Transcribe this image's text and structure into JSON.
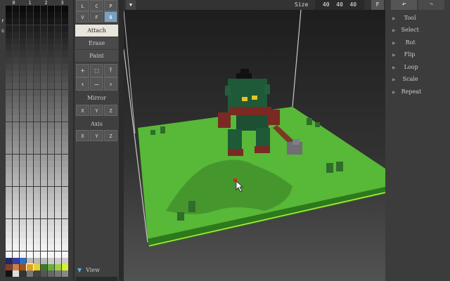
{
  "palette": {
    "columns": [
      "0",
      "1",
      "2",
      "3"
    ],
    "side_labels": [
      "F",
      "G"
    ]
  },
  "toolbar": {
    "mode_row1": [
      "L",
      "C",
      "P"
    ],
    "mode_row2": [
      "V",
      "F",
      "B"
    ],
    "attach_label": "Attach",
    "erase_label": "Erase",
    "paint_label": "Paint",
    "nav_row1": [
      "✛",
      "⬚",
      "⤒"
    ],
    "nav_row2": [
      "‹",
      "–",
      "›"
    ],
    "mirror_title": "Mirror",
    "mirror_axes": [
      "X",
      "Y",
      "Z"
    ],
    "axis_title": "Axis",
    "axis_axes": [
      "X",
      "Y",
      "Z"
    ],
    "view_label": "View"
  },
  "topbar": {
    "menu_icon": "▼",
    "size_label": "Size",
    "size_value": "40  40  40",
    "f_button": "F"
  },
  "right_panel": {
    "undo_icon": "↶",
    "redo_icon": "↷",
    "items": [
      "Tool",
      "Select",
      "Rot",
      "Flip",
      "Loop",
      "Scale",
      "Repeat"
    ]
  }
}
